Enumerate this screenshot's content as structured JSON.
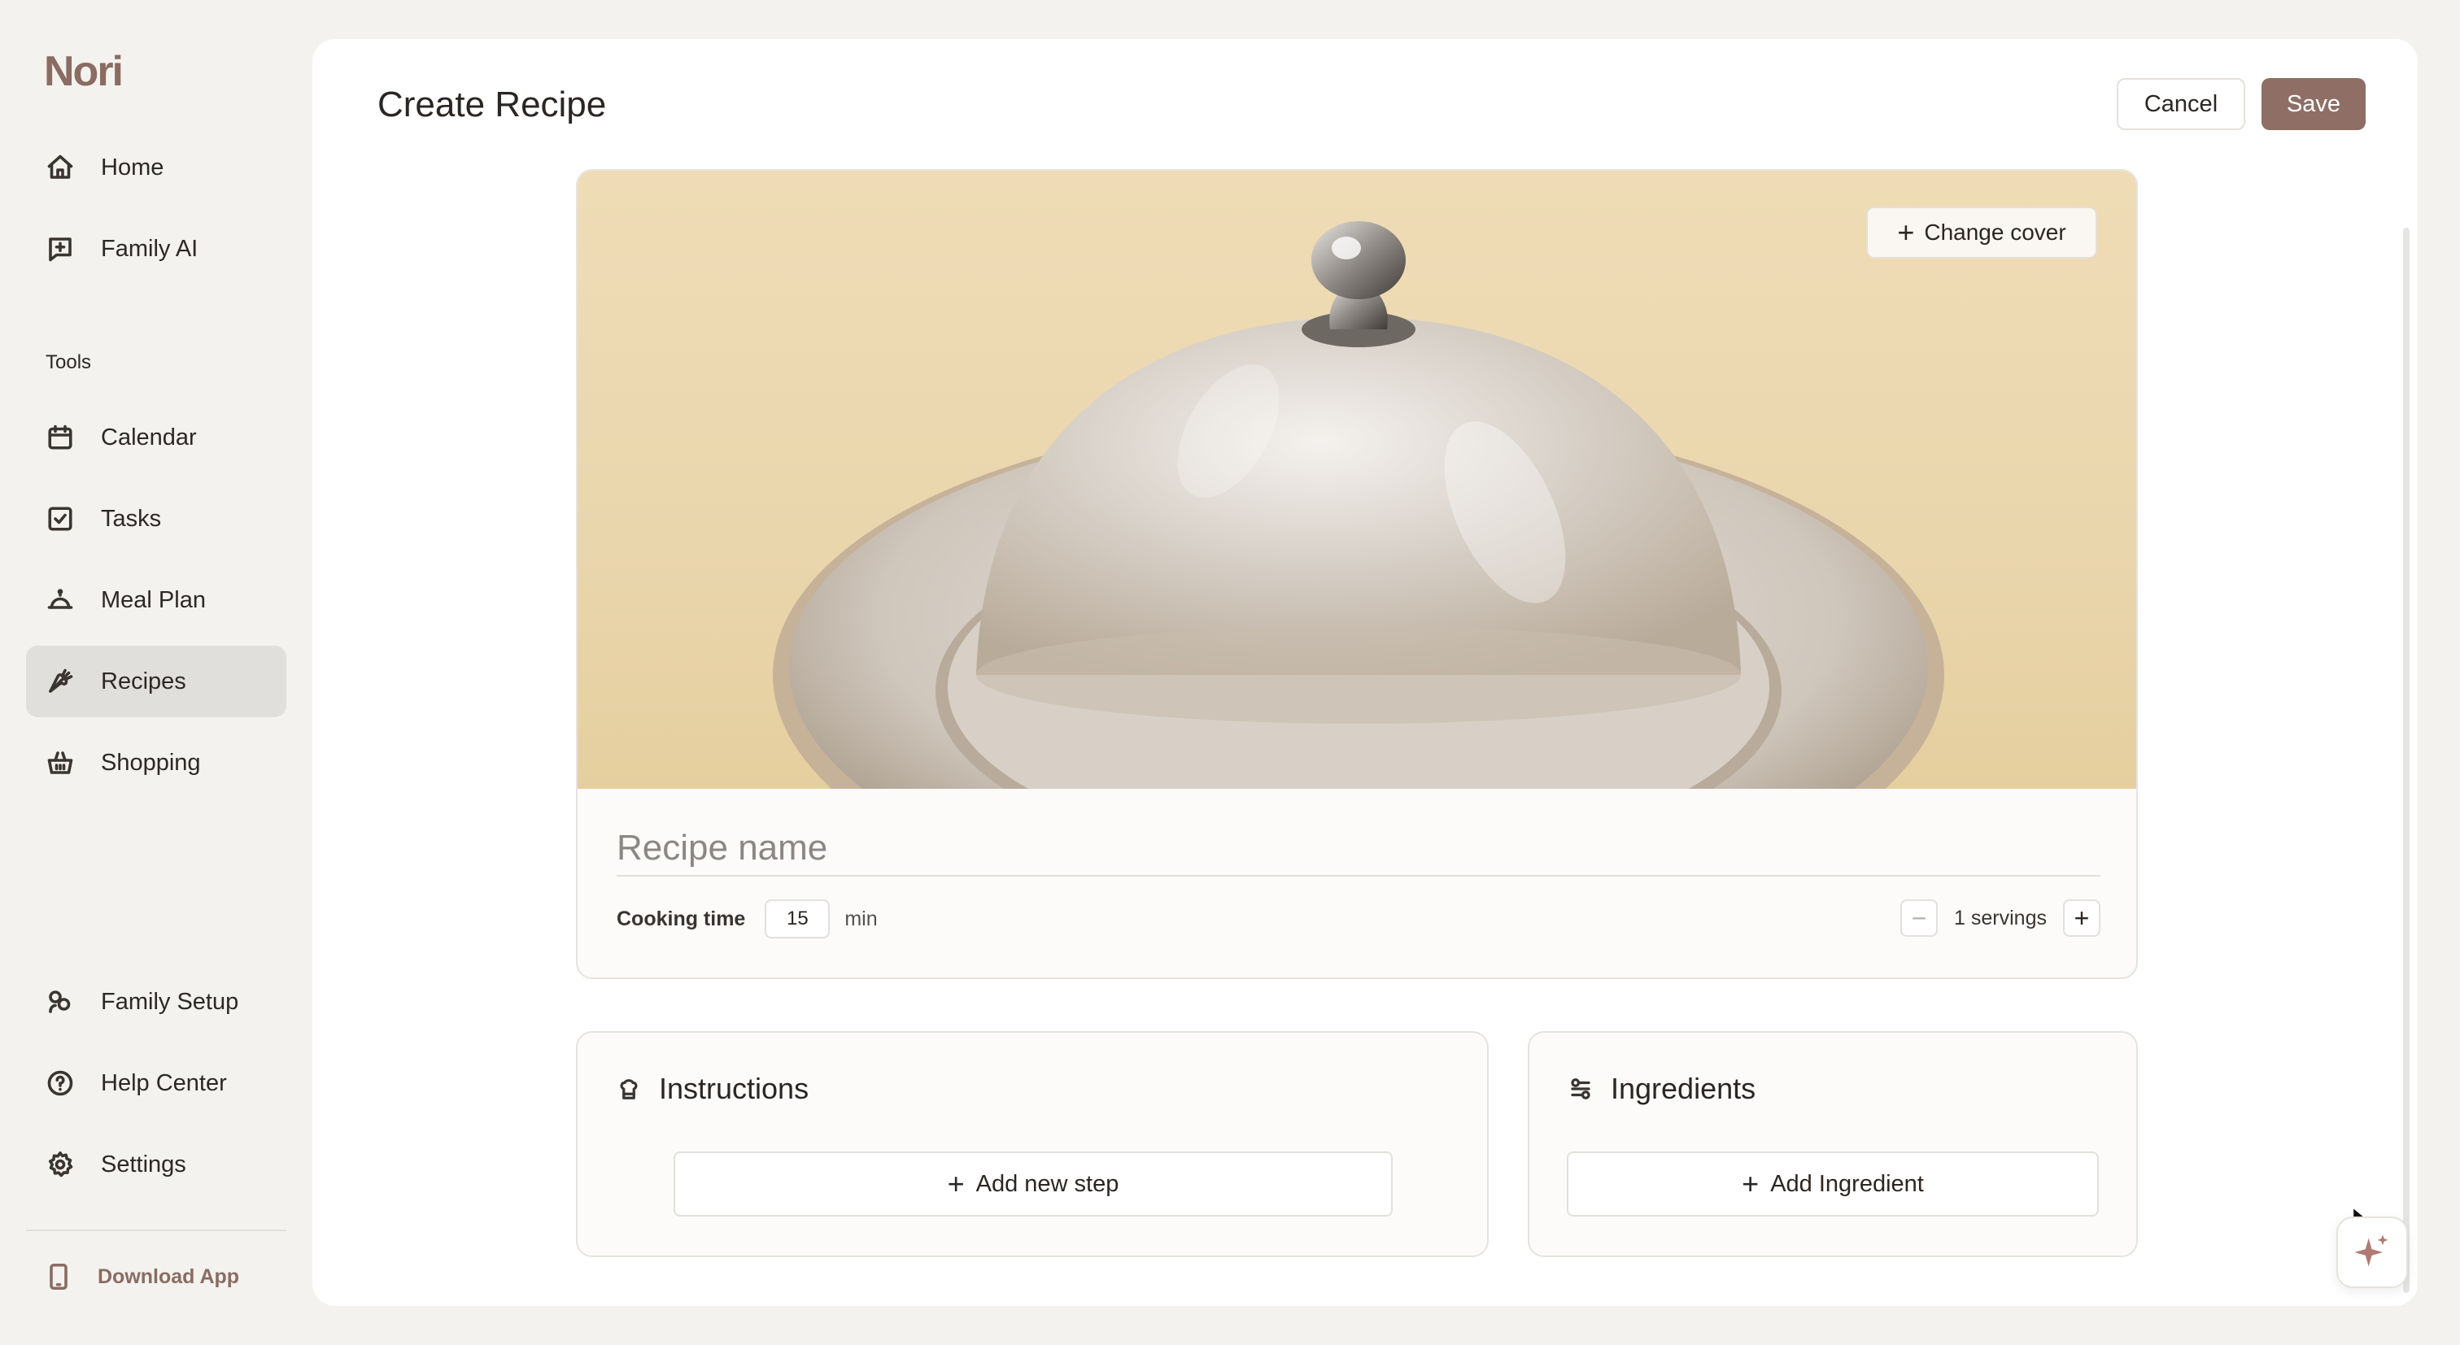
{
  "app": {
    "logo": "Nori"
  },
  "sidebar": {
    "items_top": [
      {
        "label": "Home",
        "icon": "home-icon"
      },
      {
        "label": "Family AI",
        "icon": "chat-plus-icon"
      }
    ],
    "tools_label": "Tools",
    "items_tools": [
      {
        "label": "Calendar",
        "icon": "calendar-icon"
      },
      {
        "label": "Tasks",
        "icon": "checkbox-icon"
      },
      {
        "label": "Meal Plan",
        "icon": "cloche-icon"
      },
      {
        "label": "Recipes",
        "icon": "carrot-icon",
        "active": true
      },
      {
        "label": "Shopping",
        "icon": "basket-icon"
      }
    ],
    "items_bottom": [
      {
        "label": "Family Setup",
        "icon": "family-icon"
      },
      {
        "label": "Help Center",
        "icon": "help-icon"
      },
      {
        "label": "Settings",
        "icon": "gear-icon"
      }
    ],
    "download_label": "Download App"
  },
  "header": {
    "title": "Create Recipe",
    "cancel_label": "Cancel",
    "save_label": "Save"
  },
  "recipe": {
    "change_cover_label": "Change cover",
    "name_placeholder": "Recipe name",
    "name_value": "",
    "cooking_time_label": "Cooking time",
    "cooking_time_value": "15",
    "cooking_time_unit": "min",
    "servings_text": "1 servings"
  },
  "instructions": {
    "title": "Instructions",
    "add_label": "Add new step"
  },
  "ingredients": {
    "title": "Ingredients",
    "add_label": "Add Ingredient"
  },
  "colors": {
    "accent": "#8e6e65",
    "logo": "#8a6c62",
    "active_nav_bg": "#e1dfdc",
    "page_bg": "#f3f2ef"
  }
}
